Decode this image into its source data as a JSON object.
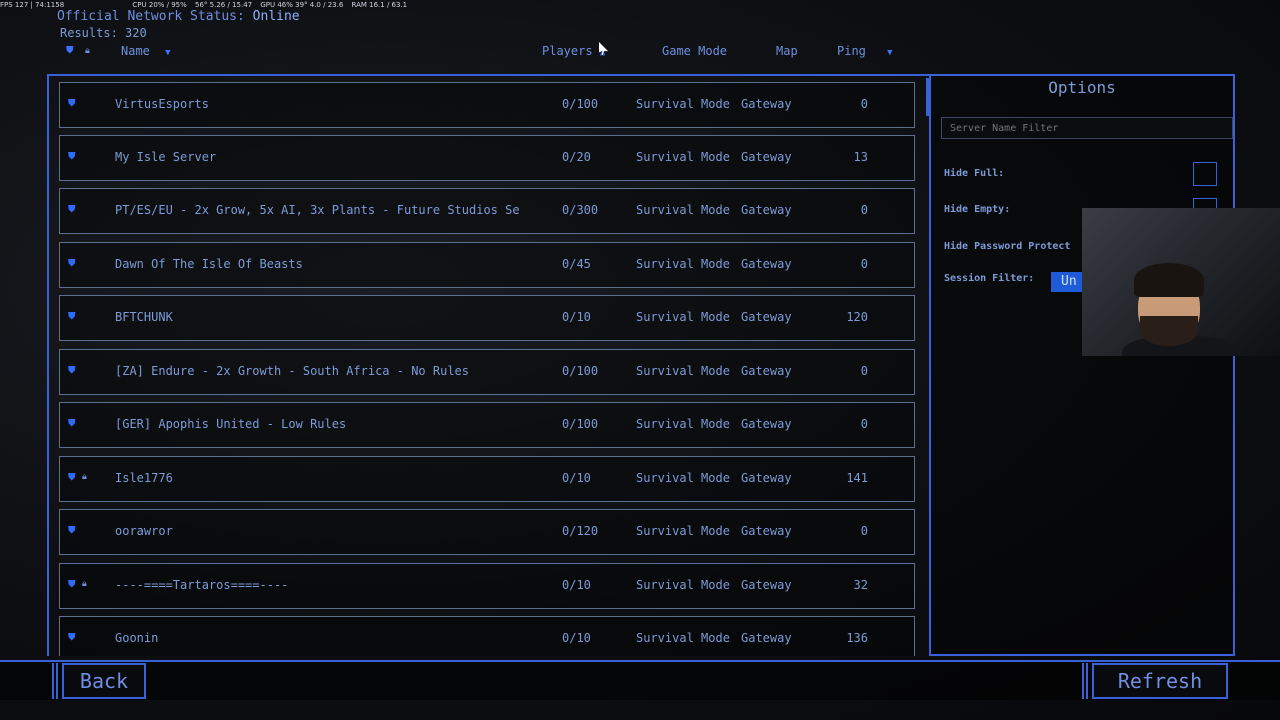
{
  "perf_overlay": [
    "FPS 127 | 74:1158",
    "CPU 20% / 95%",
    "56°  5.26 / 15.47",
    "GPU 46%  39°  4.0 / 23.6",
    "RAM 16.1 / 63.1"
  ],
  "status": {
    "label": "Official Network Status:",
    "value": "Online"
  },
  "results": {
    "label": "Results:",
    "count": "320"
  },
  "header": {
    "name": "Name",
    "players": "Players",
    "game_mode": "Game Mode",
    "map": "Map",
    "ping": "Ping"
  },
  "servers": [
    {
      "name": "VirtusEsports",
      "players": "0/100",
      "mode": "Survival Mode",
      "map": "Gateway",
      "ping": "0",
      "lock": false
    },
    {
      "name": "My Isle Server",
      "players": "0/20",
      "mode": "Survival Mode",
      "map": "Gateway",
      "ping": "13",
      "lock": false
    },
    {
      "name": "PT/ES/EU - 2x Grow, 5x AI, 3x Plants - Future Studios Se",
      "players": "0/300",
      "mode": "Survival Mode",
      "map": "Gateway",
      "ping": "0",
      "lock": false
    },
    {
      "name": "Dawn Of The Isle Of Beasts",
      "players": "0/45",
      "mode": "Survival Mode",
      "map": "Gateway",
      "ping": "0",
      "lock": false
    },
    {
      "name": "BFTCHUNK",
      "players": "0/10",
      "mode": "Survival Mode",
      "map": "Gateway",
      "ping": "120",
      "lock": false
    },
    {
      "name": "[ZA] Endure - 2x Growth - South Africa - No Rules",
      "players": "0/100",
      "mode": "Survival Mode",
      "map": "Gateway",
      "ping": "0",
      "lock": false
    },
    {
      "name": "[GER] Apophis United - Low Rules",
      "players": "0/100",
      "mode": "Survival Mode",
      "map": "Gateway",
      "ping": "0",
      "lock": false
    },
    {
      "name": "Isle1776",
      "players": "0/10",
      "mode": "Survival Mode",
      "map": "Gateway",
      "ping": "141",
      "lock": true
    },
    {
      "name": "oorawror",
      "players": "0/120",
      "mode": "Survival Mode",
      "map": "Gateway",
      "ping": "0",
      "lock": false
    },
    {
      "name": "----====Tartaros====----",
      "players": "0/10",
      "mode": "Survival Mode",
      "map": "Gateway",
      "ping": "32",
      "lock": true
    },
    {
      "name": "Goonin",
      "players": "0/10",
      "mode": "Survival Mode",
      "map": "Gateway",
      "ping": "136",
      "lock": false
    }
  ],
  "options": {
    "title": "Options",
    "filter_placeholder": "Server Name Filter",
    "hide_full": "Hide Full:",
    "hide_empty": "Hide Empty:",
    "hide_password": "Hide Password Protect",
    "session_filter": "Session Filter:",
    "session_value": "Un"
  },
  "buttons": {
    "back": "Back",
    "refresh": "Refresh"
  },
  "colors": {
    "accent": "#3a62d8",
    "text": "#7d9bd8",
    "shield": "#2f6bff"
  }
}
